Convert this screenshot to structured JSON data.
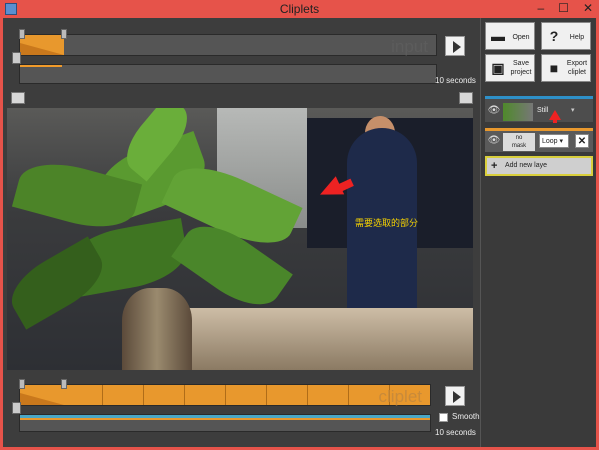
{
  "window": {
    "title": "Cliplets"
  },
  "input_timeline": {
    "ghost_label": "input",
    "duration": "10 seconds",
    "progress": 0.1
  },
  "toolbar": {
    "open_label": "Open",
    "help_label": "Help",
    "save_label_1": "Save",
    "save_label_2": "project",
    "export_label_1": "Export",
    "export_label_2": "cliplet"
  },
  "layers": {
    "still": {
      "label": "Still"
    },
    "loop": {
      "mask_label_1": "no",
      "mask_label_2": "mask",
      "mode": "Loop"
    },
    "add_label": "Add new laye"
  },
  "annotation": {
    "text": "需要选取的部分"
  },
  "cliplet_timeline": {
    "ghost_label": "cliplet",
    "smooth_label": "Smooth",
    "duration": "10 seconds"
  },
  "colors": {
    "accent_orange": "#e8982d",
    "accent_blue": "#2e90c8",
    "annotation_red": "#e22222",
    "annotation_yellow": "#f5d200"
  }
}
